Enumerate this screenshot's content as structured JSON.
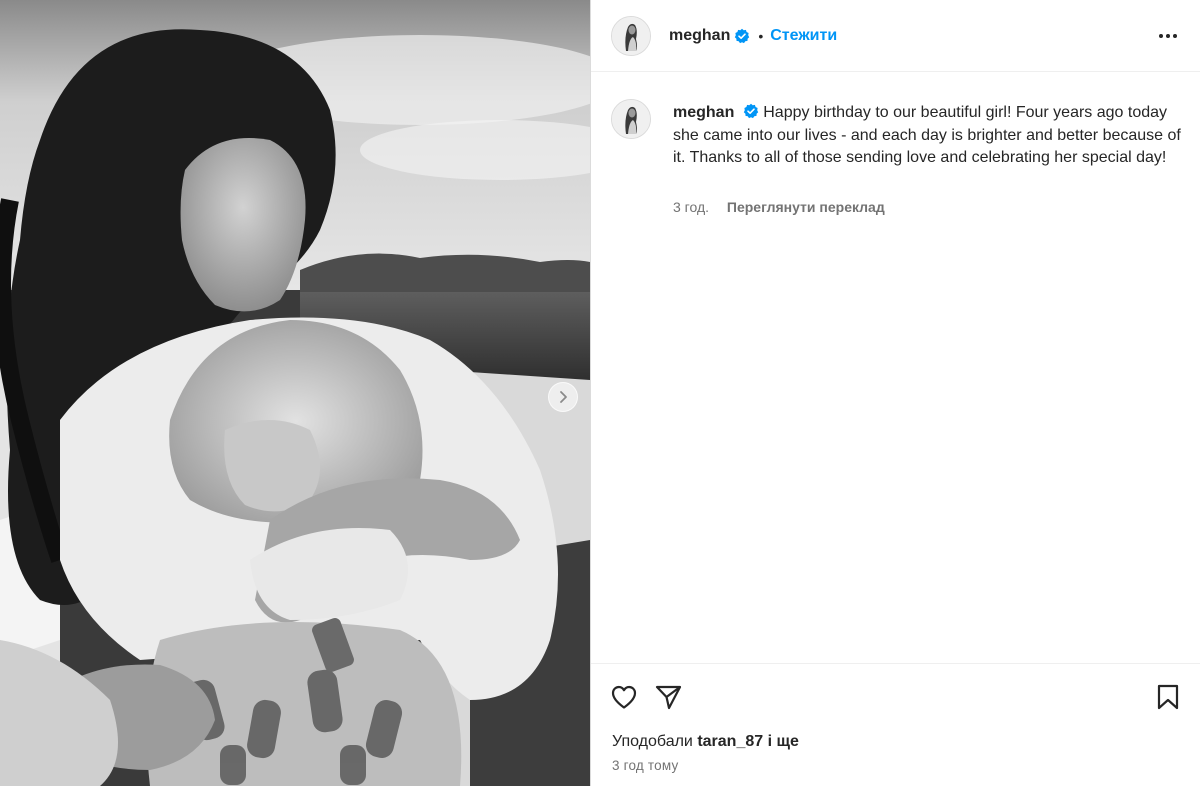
{
  "post": {
    "photo_alt": "Black and white photo of a woman holding a child on a boat"
  },
  "header": {
    "username": "meghan",
    "dot": "•",
    "follow_label": "Стежити",
    "more_icon": "more-options-icon",
    "verified_icon": "verified-badge-icon"
  },
  "caption": {
    "username": "meghan",
    "text": "Happy birthday to our beautiful girl! Four years ago today she came into our lives - and each day is brighter and better because of it. Thanks to all of those sending love and celebrating her special day!",
    "age": "3 год.",
    "translate_label": "Переглянути переклад"
  },
  "footer": {
    "liked_by_prefix": "Уподобали",
    "liked_by_user": "taran_87",
    "liked_by_suffix": "і ще",
    "timestamp": "3 год тому"
  },
  "colors": {
    "accent": "#0095f6",
    "verified": "#0095f6",
    "text": "#262626",
    "muted": "#737373",
    "border": "#dbdbdb"
  }
}
